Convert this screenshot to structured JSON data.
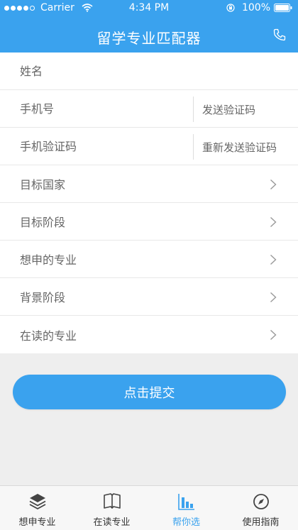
{
  "status_bar": {
    "carrier": "Carrier",
    "time": "4:34 PM",
    "battery": "100%"
  },
  "nav": {
    "title": "留学专业匹配器",
    "phone_icon": "phone-icon"
  },
  "form": {
    "name_placeholder": "姓名",
    "phone_placeholder": "手机号",
    "send_code": "发送验证码",
    "code_placeholder": "手机验证码",
    "resend_code": "重新发送验证码",
    "select_rows": [
      "目标国家",
      "目标阶段",
      "想申的专业",
      "背景阶段",
      "在读的专业"
    ]
  },
  "submit_label": "点击提交",
  "tabs": [
    {
      "label": "想申专业",
      "icon": "layers-icon",
      "active": false
    },
    {
      "label": "在读专业",
      "icon": "book-icon",
      "active": false
    },
    {
      "label": "帮你选",
      "icon": "bar-chart-icon",
      "active": true
    },
    {
      "label": "使用指南",
      "icon": "compass-icon",
      "active": false
    }
  ],
  "colors": {
    "primary": "#3aa2ee",
    "background": "#eeeeee",
    "tabbar": "#f7f7f7"
  }
}
